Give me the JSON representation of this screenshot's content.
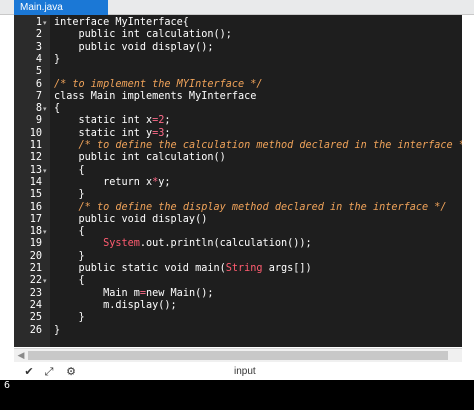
{
  "tab": {
    "title": "Main.java"
  },
  "editor": {
    "lines": [
      {
        "n": "1",
        "fold": "▾",
        "html": "<span class=\"kw\">interface</span> MyInterface{"
      },
      {
        "n": "2",
        "fold": "",
        "html": "    public int calculation();"
      },
      {
        "n": "3",
        "fold": "",
        "html": "    public void display();"
      },
      {
        "n": "4",
        "fold": "",
        "html": "}"
      },
      {
        "n": "5",
        "fold": "",
        "html": ""
      },
      {
        "n": "6",
        "fold": "",
        "html": "<span class=\"cmt\">/* to implement the MYInterface */</span>"
      },
      {
        "n": "7",
        "fold": "",
        "html": "class Main implements MyInterface"
      },
      {
        "n": "8",
        "fold": "▾",
        "html": "{"
      },
      {
        "n": "9",
        "fold": "",
        "html": "    static int x<span class=\"op\">=</span><span class=\"num\">2</span>;"
      },
      {
        "n": "10",
        "fold": "",
        "html": "    static int y<span class=\"op\">=</span><span class=\"num\">3</span>;"
      },
      {
        "n": "11",
        "fold": "",
        "html": "    <span class=\"cmt\">/* to define the calculation method declared in the interface */</span>"
      },
      {
        "n": "12",
        "fold": "",
        "html": "    public int calculation()"
      },
      {
        "n": "13",
        "fold": "▾",
        "html": "    {"
      },
      {
        "n": "14",
        "fold": "",
        "html": "        return x<span class=\"op\">*</span>y;"
      },
      {
        "n": "15",
        "fold": "",
        "html": "    }"
      },
      {
        "n": "16",
        "fold": "",
        "html": "    <span class=\"cmt\">/* to define the display method declared in the interface */</span>"
      },
      {
        "n": "17",
        "fold": "",
        "html": "    public void display()"
      },
      {
        "n": "18",
        "fold": "▾",
        "html": "    {"
      },
      {
        "n": "19",
        "fold": "",
        "html": "        <span class=\"cls\">System</span>.out.println(calculation());"
      },
      {
        "n": "20",
        "fold": "",
        "html": "    }"
      },
      {
        "n": "21",
        "fold": "",
        "html": "    public static void main(<span class=\"cls\">String</span> args[])"
      },
      {
        "n": "22",
        "fold": "▾",
        "html": "    {"
      },
      {
        "n": "23",
        "fold": "",
        "html": "        Main m<span class=\"op\">=</span>new Main();"
      },
      {
        "n": "24",
        "fold": "",
        "html": "        m.display();"
      },
      {
        "n": "25",
        "fold": "",
        "html": "    }"
      },
      {
        "n": "26",
        "fold": "",
        "html": "}"
      }
    ]
  },
  "toolbar": {
    "icons": [
      "chevron-down-icon",
      "expand-icon",
      "settings-icon"
    ],
    "input_label": "input"
  },
  "output": {
    "value": "6"
  }
}
